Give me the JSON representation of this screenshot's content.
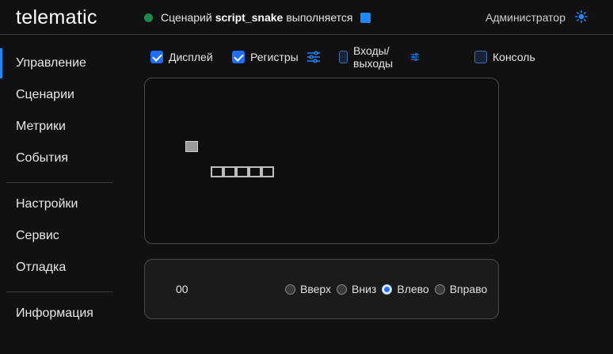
{
  "header": {
    "logo_prefix": "tele",
    "logo_suffix": "matic",
    "status_prefix": "Сценарий",
    "script_name": "script_snake",
    "status_suffix": "выполняется",
    "status_color": "#1f8a4c",
    "user": "Администратор",
    "theme_icon": "sun-icon"
  },
  "sidebar": {
    "group1": [
      {
        "label": "Управление",
        "active": true
      },
      {
        "label": "Сценарии"
      },
      {
        "label": "Метрики"
      },
      {
        "label": "События"
      }
    ],
    "group2": [
      {
        "label": "Настройки"
      },
      {
        "label": "Сервис"
      },
      {
        "label": "Отладка"
      }
    ],
    "group3": [
      {
        "label": "Информация"
      }
    ]
  },
  "toggles": [
    {
      "label": "Дисплей",
      "checked": true
    },
    {
      "label": "Регистры",
      "checked": true
    },
    {
      "label": "Входы/выходы",
      "checked": false
    },
    {
      "label": "Консоль",
      "checked": false
    }
  ],
  "controls": {
    "score": "00",
    "directions": [
      {
        "label": "Вверх",
        "selected": false
      },
      {
        "label": "Вниз",
        "selected": false
      },
      {
        "label": "Влево",
        "selected": true
      },
      {
        "label": "Вправо",
        "selected": false
      }
    ]
  },
  "colors": {
    "accent": "#1e88ff",
    "background": "#111111"
  }
}
